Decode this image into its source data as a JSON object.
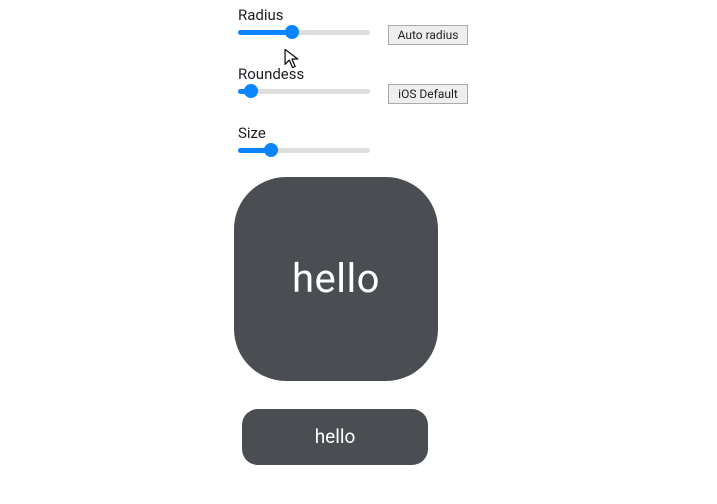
{
  "controls": {
    "radius": {
      "label": "Radius",
      "value": 40,
      "button": "Auto radius"
    },
    "roundness": {
      "label": "Roundess",
      "value": 5,
      "button": "iOS Default"
    },
    "size": {
      "label": "Size",
      "value": 22
    }
  },
  "preview": {
    "squircle_label": "hello",
    "button_label": "hello"
  },
  "colors": {
    "shape_fill": "#4a4d51",
    "accent": "#0a84ff"
  }
}
